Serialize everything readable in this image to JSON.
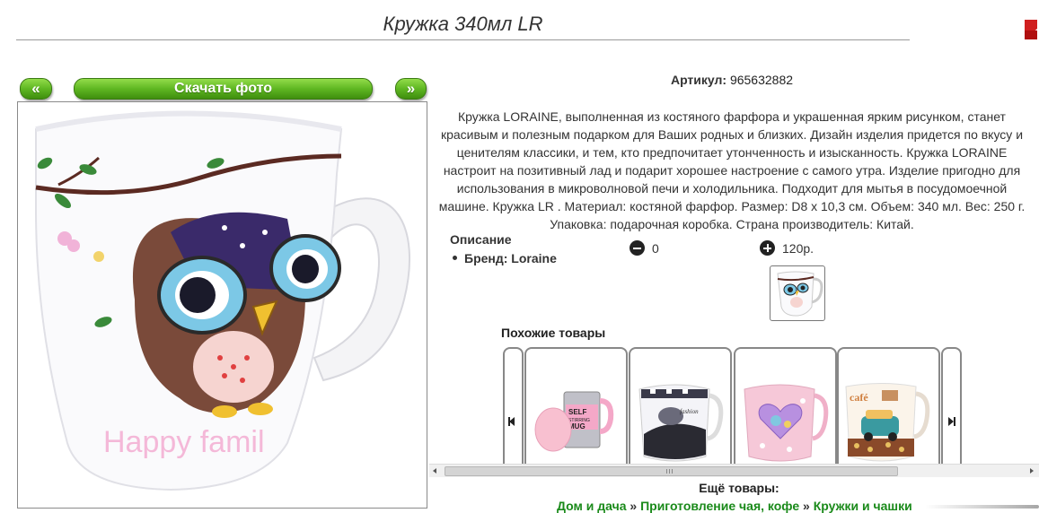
{
  "header": {
    "title": "Кружка 340мл LR"
  },
  "gallery": {
    "prev_label": "«",
    "download_label": "Скачать фото",
    "next_label": "»",
    "photo_text": "Happy famil"
  },
  "product": {
    "sku_label": "Артикул:",
    "sku_value": "965632882",
    "description": "Кружка LORAINE, выполненная из костяного фарфора и украшенная ярким рисунком, станет красивым и полезным подарком для Ваших родных и близких. Дизайн изделия придется по вкусу и ценителям классики, и тем, кто предпочитает утонченность и изысканность. Кружка LORAINE настроит на позитивный лад и подарит хорошее настроение с самого утра. Изделие пригодно для использования в микроволновой печи и холодильника. Подходит для мытья в посудомоечной машине. Кружка LR . Материал: костяной фарфор. Размер: D8 x 10,3 см. Объем: 340 мл. Вес: 250 г. Упаковка: подарочная коробка. Страна производитель: Китай.",
    "desc_heading": "Описание",
    "brand_label": "Бренд: Loraine",
    "minus_value": "0",
    "plus_value": "120р."
  },
  "similar": {
    "title": "Похожие товары",
    "items": [
      {
        "name": "self-stirring-mug",
        "print": "SELF STIRRING MUG"
      },
      {
        "name": "car-print-mug",
        "print": "fashion"
      },
      {
        "name": "heart-print-mug",
        "print": ""
      },
      {
        "name": "retro-car-mug",
        "print": "café"
      }
    ]
  },
  "more": {
    "label": "Ещё товары:",
    "crumbs": [
      "Дом и дача",
      "Приготовление чая, кофе",
      "Кружки и чашки"
    ],
    "separator": " » "
  },
  "icons": {
    "prev": "chevron-left-icon",
    "next": "chevron-right-icon",
    "minus": "minus-circle-icon",
    "plus": "plus-circle-icon"
  },
  "colors": {
    "button_green": "#5fb722",
    "link_green": "#1a8a1a",
    "owl_blue": "#7cc8e6",
    "accent_red": "#d01f1f"
  }
}
